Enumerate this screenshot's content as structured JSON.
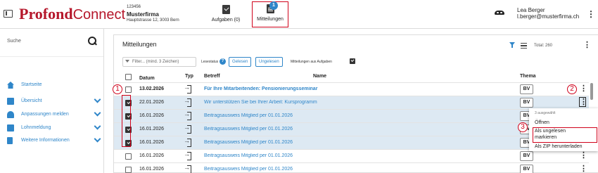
{
  "header": {
    "brand_bold": "Profond",
    "brand_rest": "Connect",
    "company_number": "123456",
    "company_name": "Musterfirma",
    "company_address": "Hauptstrasse 12, 3003 Bern",
    "tasks_label": "Aufgaben (0)",
    "messages_label": "Mitteilungen",
    "messages_badge": "1",
    "user_name": "Lea Berger",
    "user_email": "l.berger@musterfirma.ch"
  },
  "sidebar": {
    "search_placeholder": "Suche",
    "items": [
      {
        "label": "Startseite",
        "icon": "home-icon"
      },
      {
        "label": "Übersicht",
        "icon": "buildings-icon"
      },
      {
        "label": "Anpassungen melden",
        "icon": "people-icon"
      },
      {
        "label": "Lohnmeldung",
        "icon": "folder-icon"
      },
      {
        "label": "Weitere Informationen",
        "icon": "document-icon"
      }
    ]
  },
  "panel": {
    "title": "Mitteilungen",
    "total": "Total: 260",
    "filter_placeholder": "Filter... (mind. 3 Zeichen)",
    "lesestatus": "Lesestatus",
    "chip_read": "Gelesen",
    "chip_unread": "Ungelesen",
    "from_tasks": "Mitteilungen aus Aufgaben",
    "columns": {
      "date": "Datum",
      "sort_arrow": "↓",
      "type": "Typ",
      "subject": "Betreff",
      "name": "Name",
      "theme": "Thema"
    }
  },
  "rows": [
    {
      "date": "13.02.2026",
      "subject": "Für Ihre Mitarbeitenden: Pensionierungsseminar",
      "theme": "BV",
      "checked": false,
      "bold": true
    },
    {
      "date": "22.01.2026",
      "subject": "Wir unterstützen Sie bei Ihrer Arbeit: Kursprogramm",
      "theme": "BV",
      "checked": true,
      "bold": false
    },
    {
      "date": "16.01.2026",
      "subject": "Beitragsausweis Mitglied per 01.01.2026",
      "theme": "BV",
      "checked": true,
      "bold": false
    },
    {
      "date": "16.01.2026",
      "subject": "Beitragsausweis Mitglied per 01.01.2026",
      "theme": "BV",
      "checked": true,
      "bold": false
    },
    {
      "date": "16.01.2026",
      "subject": "Beitragsausweis Mitglied per 01.01.2026",
      "theme": "BV",
      "checked": true,
      "bold": false
    },
    {
      "date": "16.01.2026",
      "subject": "Beitragsausweis Mitglied per 01.01.2026",
      "theme": "BV",
      "checked": false,
      "bold": false
    },
    {
      "date": "16.01.2026",
      "subject": "Beitragsausweis Mitglied per 01.01.2026",
      "theme": "BV",
      "checked": false,
      "bold": false
    }
  ],
  "context_menu": {
    "count": "3 ausgewählt",
    "open": "Öffnen",
    "mark_unread_1": "Als ungelesen",
    "mark_unread_2": "markieren",
    "zip": "Als ZIP herunterladen"
  },
  "annotations": [
    "1",
    "2",
    "3"
  ],
  "colors": {
    "accent": "#2f86c9",
    "brand": "#b5172b",
    "annotation": "#d0021b",
    "selected_row": "#dde9f3"
  }
}
